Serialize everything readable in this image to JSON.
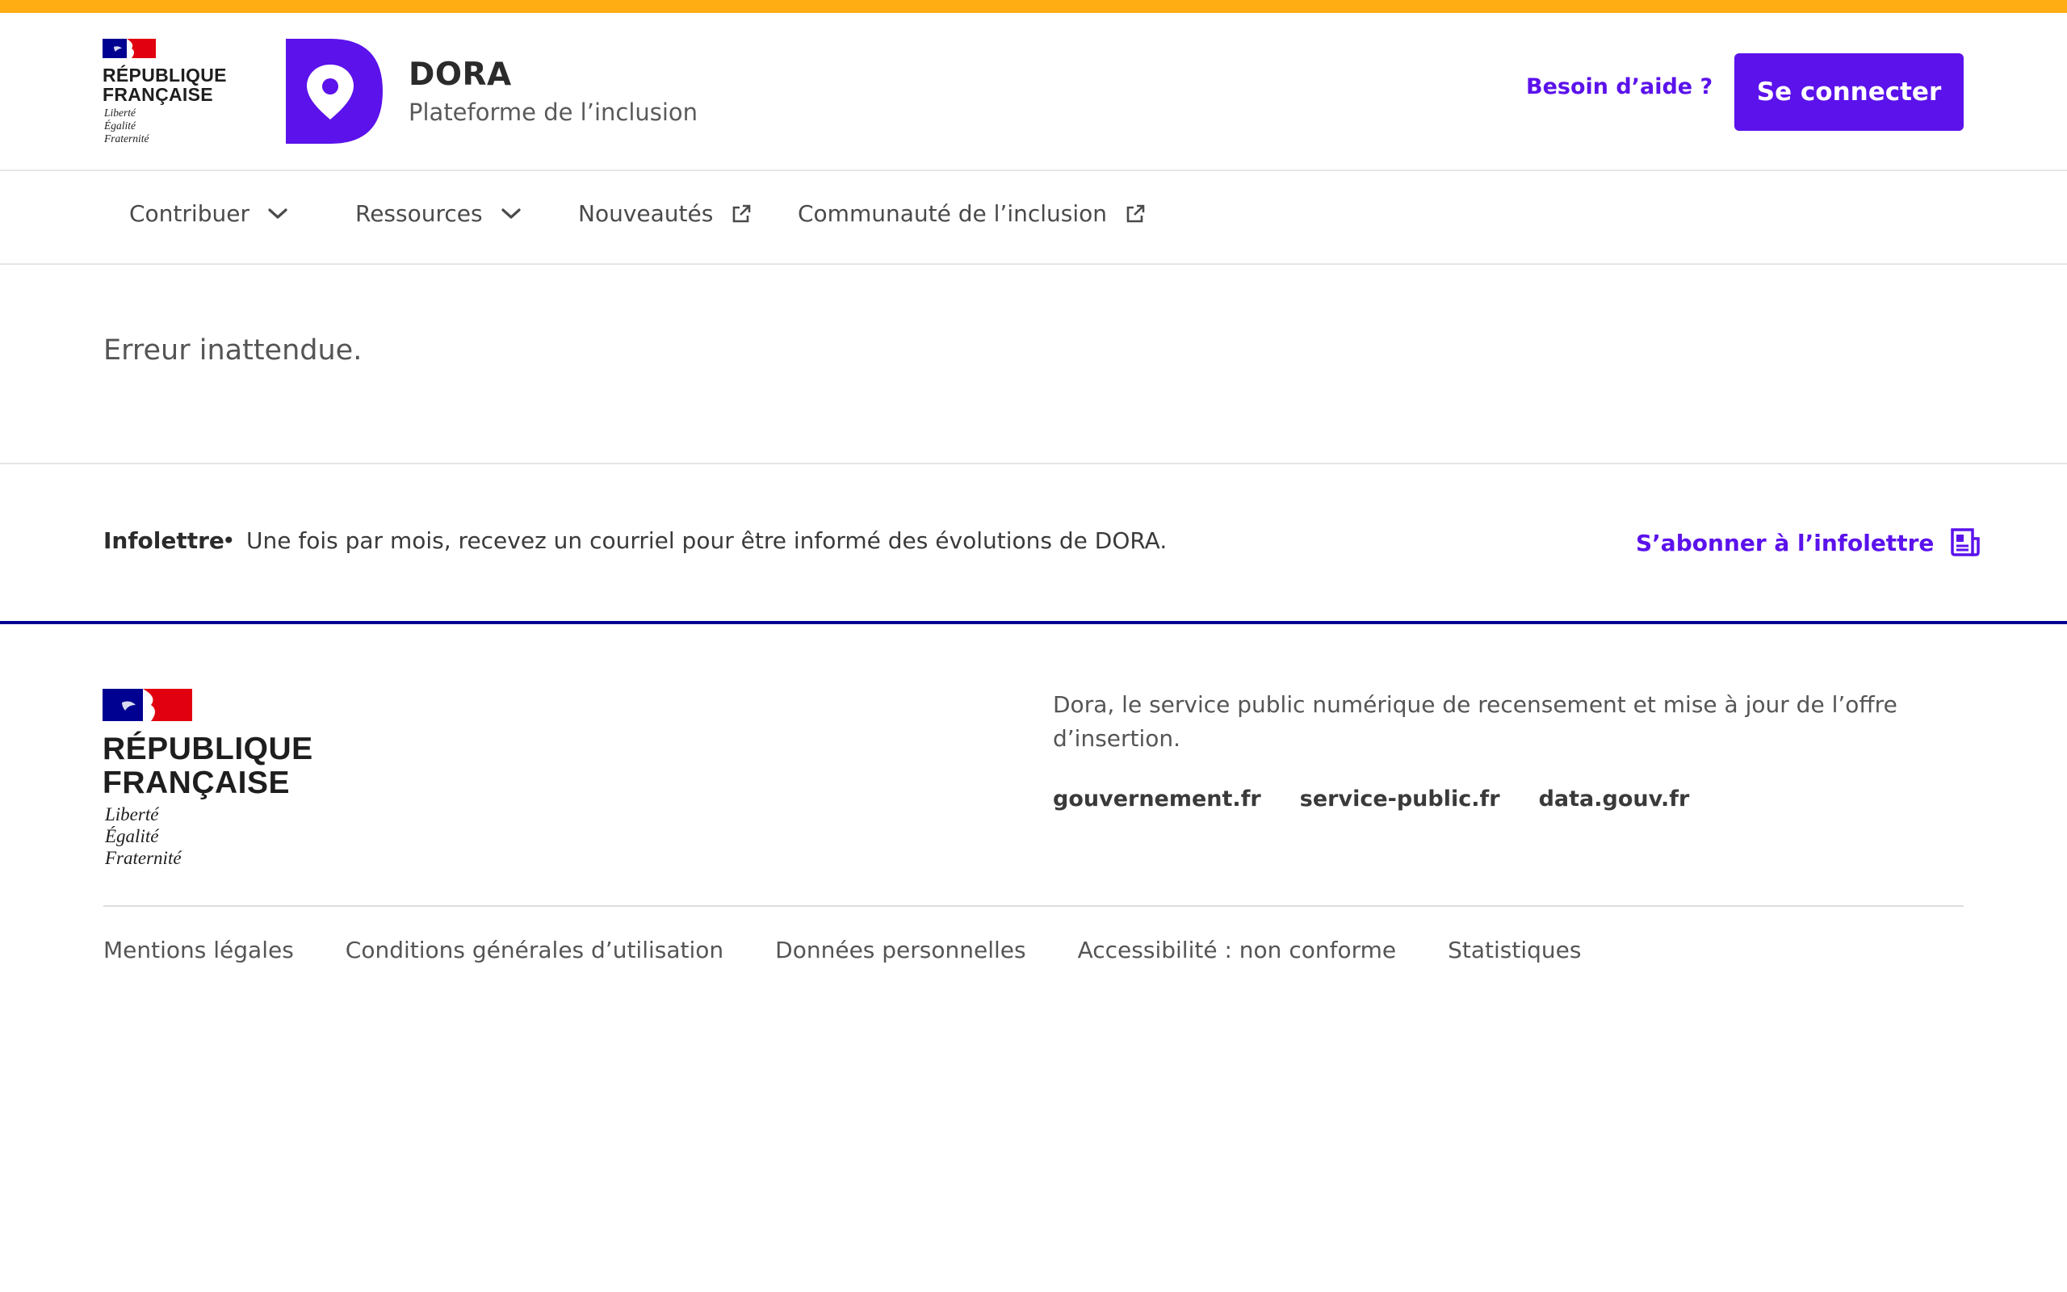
{
  "header": {
    "gov_title_line1": "RÉPUBLIQUE",
    "gov_title_line2": "FRANÇAISE",
    "motto_1": "Liberté",
    "motto_2": "Égalité",
    "motto_3": "Fraternité",
    "brand_name": "DORA",
    "brand_tagline": "Plateforme de l’inclusion",
    "help_label": "Besoin d’aide ?",
    "login_label": "Se connecter"
  },
  "nav": {
    "items": [
      {
        "label": "Contribuer",
        "icon": "chevron-down-icon"
      },
      {
        "label": "Ressources",
        "icon": "chevron-down-icon"
      },
      {
        "label": "Nouveautés",
        "icon": "external-link-icon"
      },
      {
        "label": "Communauté de l’inclusion",
        "icon": "external-link-icon"
      }
    ]
  },
  "main": {
    "error_message": "Erreur inattendue."
  },
  "newsletter": {
    "label": "Infolettre",
    "separator": "•",
    "text": "Une fois par mois, recevez un courriel pour être informé des évolutions de DORA.",
    "subscribe_label": "S’abonner à l’infolettre"
  },
  "footer": {
    "description": "Dora, le service public numérique de recensement et mise à jour de l’offre d’insertion.",
    "links": [
      "gouvernement.fr",
      "service-public.fr",
      "data.gouv.fr"
    ],
    "bottom_links": [
      "Mentions légales",
      "Conditions générales d’utilisation",
      "Données personnelles",
      "Accessibilité : non conforme",
      "Statistiques"
    ]
  },
  "colors": {
    "accent": "#5b12eb",
    "top_bar": "#ffad12",
    "gov_blue": "#000091",
    "gov_red": "#e1000f"
  }
}
